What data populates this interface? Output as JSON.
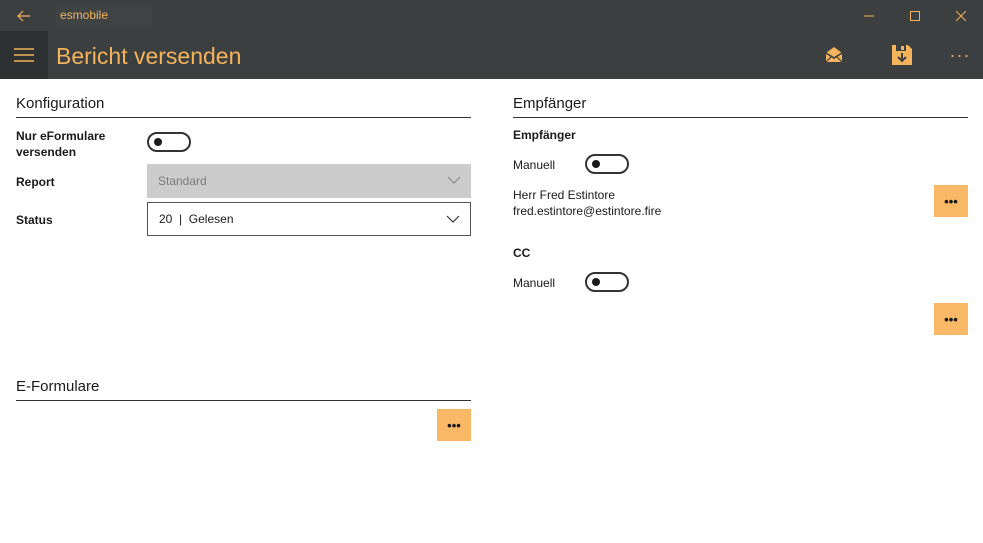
{
  "window": {
    "app_name": "esmobile",
    "icons": {
      "back": "back-arrow-icon",
      "minimize": "minimize-icon",
      "maximize": "maximize-icon",
      "close": "close-icon"
    }
  },
  "appbar": {
    "title": "Bericht versenden",
    "icons": [
      "hamburger-menu-icon",
      "send-mail-icon",
      "save-download-icon",
      "more-icon"
    ],
    "more_label": "···"
  },
  "konfiguration": {
    "title": "Konfiguration",
    "nur_eformulare_label": "Nur eFormulare versenden",
    "nur_eformulare_on": false,
    "report_label": "Report",
    "report_value": "Standard",
    "status_label": "Status",
    "status_value": "20  |  Gelesen"
  },
  "empfaenger": {
    "title": "Empfänger",
    "empfaenger_sub": "Empfänger",
    "manuell_label": "Manuell",
    "manuell_on": false,
    "recipient_name": "Herr Fred Estintore",
    "recipient_email": "fred.estintore@estintore.fire",
    "cc_label": "CC",
    "cc_manuell_label": "Manuell",
    "cc_manuell_on": false
  },
  "eformulare": {
    "title": "E-Formulare"
  },
  "buttons": {
    "dots": "•••"
  },
  "colors": {
    "accent": "#f5b35b",
    "button_bg": "#f9b865",
    "bar_bg": "#3b3f40",
    "disabled_bg": "#cccccc"
  }
}
